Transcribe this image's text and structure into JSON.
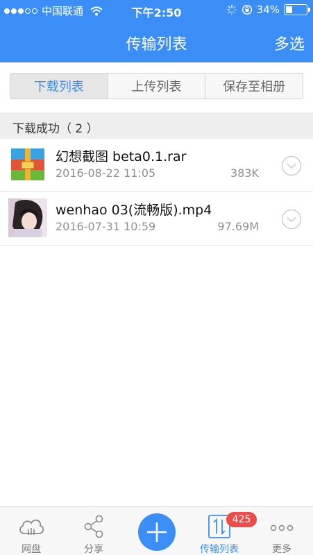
{
  "status_bar": {
    "carrier": "中国联通",
    "time": "下午2:50",
    "battery_percent": "34%",
    "battery_level": 0.34
  },
  "nav": {
    "title": "传输列表",
    "right_button": "多选"
  },
  "segments": [
    {
      "label": "下载列表",
      "active": true
    },
    {
      "label": "上传列表",
      "active": false
    },
    {
      "label": "保存至相册",
      "active": false
    }
  ],
  "section": {
    "title": "下载成功（ 2 ）"
  },
  "files": [
    {
      "name": "幻想截图 beta0.1.rar",
      "date": "2016-08-22 11:05",
      "size": "383K",
      "icon": "rar-archive-icon"
    },
    {
      "name": "wenhao 03(流畅版).mp4",
      "date": "2016-07-31 10:59",
      "size": "97.69M",
      "icon": "video-thumbnail"
    }
  ],
  "tabbar": {
    "tabs": [
      {
        "label": "网盘",
        "icon": "cloud-icon",
        "active": false
      },
      {
        "label": "分享",
        "icon": "share-icon",
        "active": false
      },
      {
        "label": "",
        "icon": "plus-icon",
        "active": false
      },
      {
        "label": "传输列表",
        "icon": "transfer-icon",
        "active": true
      },
      {
        "label": "更多",
        "icon": "more-dots-icon",
        "active": false
      }
    ],
    "badge_count": "425"
  },
  "colors": {
    "accent": "#3a8ef5",
    "badge": "#ee4b4b",
    "secondary_text": "#8f8f8f"
  }
}
